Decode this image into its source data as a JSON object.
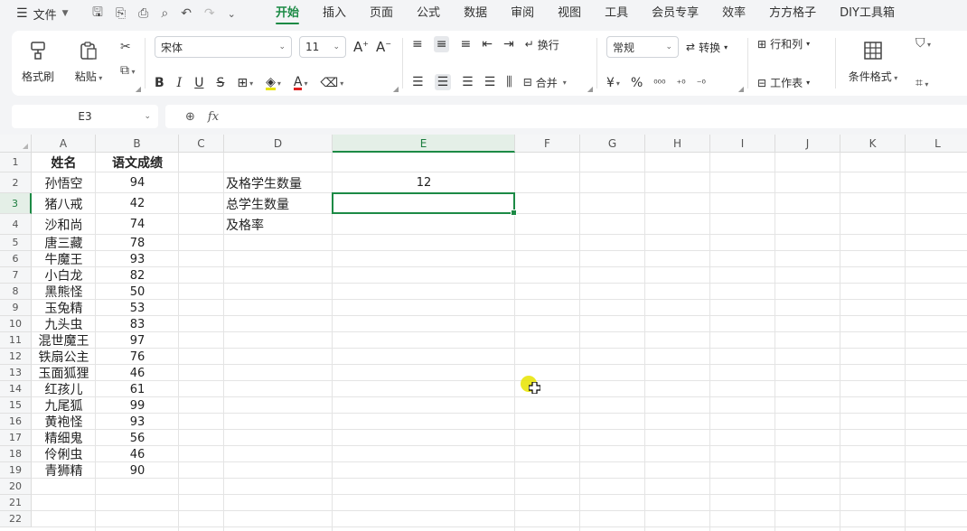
{
  "menubar": {
    "file_label": "文件",
    "tabs": [
      "开始",
      "插入",
      "页面",
      "公式",
      "数据",
      "审阅",
      "视图",
      "工具",
      "会员专享",
      "效率",
      "方方格子",
      "DIY工具箱"
    ],
    "active_tab": "开始"
  },
  "ribbon": {
    "format_painter": "格式刷",
    "paste": "粘贴",
    "font_name": "宋体",
    "font_size": "11",
    "bold": "B",
    "italic": "I",
    "underline": "U",
    "strike": "S",
    "wrap": "换行",
    "merge": "合并",
    "number_format": "常规",
    "convert": "转换",
    "row_col": "行和列",
    "worksheet": "工作表",
    "cond_format": "条件格式",
    "currency": "¥",
    "percent": "%"
  },
  "formula_bar": {
    "cell_ref": "E3",
    "fx": "fx",
    "content": ""
  },
  "grid": {
    "columns": [
      "A",
      "B",
      "C",
      "D",
      "E",
      "F",
      "G",
      "H",
      "I",
      "J",
      "K",
      "L"
    ],
    "selected_column": "E",
    "rows": [
      "1",
      "2",
      "3",
      "4",
      "5",
      "6",
      "7",
      "8",
      "9",
      "10",
      "11",
      "12",
      "13",
      "14",
      "15",
      "16",
      "17",
      "18",
      "19",
      "20",
      "21",
      "22"
    ],
    "selected_row": "3",
    "header_name": "姓名",
    "header_score": "语文成绩",
    "students": [
      {
        "name": "孙悟空",
        "score": "94"
      },
      {
        "name": "猪八戒",
        "score": "42"
      },
      {
        "name": "沙和尚",
        "score": "74"
      },
      {
        "name": "唐三藏",
        "score": "78"
      },
      {
        "name": "牛魔王",
        "score": "93"
      },
      {
        "name": "小白龙",
        "score": "82"
      },
      {
        "name": "黑熊怪",
        "score": "50"
      },
      {
        "name": "玉兔精",
        "score": "53"
      },
      {
        "name": "九头虫",
        "score": "83"
      },
      {
        "name": "混世魔王",
        "score": "97"
      },
      {
        "name": "铁扇公主",
        "score": "76"
      },
      {
        "name": "玉面狐狸",
        "score": "46"
      },
      {
        "name": "红孩儿",
        "score": "61"
      },
      {
        "name": "九尾狐",
        "score": "99"
      },
      {
        "name": "黄袍怪",
        "score": "93"
      },
      {
        "name": "精细鬼",
        "score": "56"
      },
      {
        "name": "伶俐虫",
        "score": "46"
      },
      {
        "name": "青狮精",
        "score": "90"
      }
    ],
    "labels": {
      "pass_count": "及格学生数量",
      "total_count": "总学生数量",
      "pass_rate": "及格率"
    },
    "values": {
      "pass_count": "12"
    }
  },
  "colors": {
    "accent": "#1c8a45",
    "cursor_highlight": "#e8e400"
  }
}
